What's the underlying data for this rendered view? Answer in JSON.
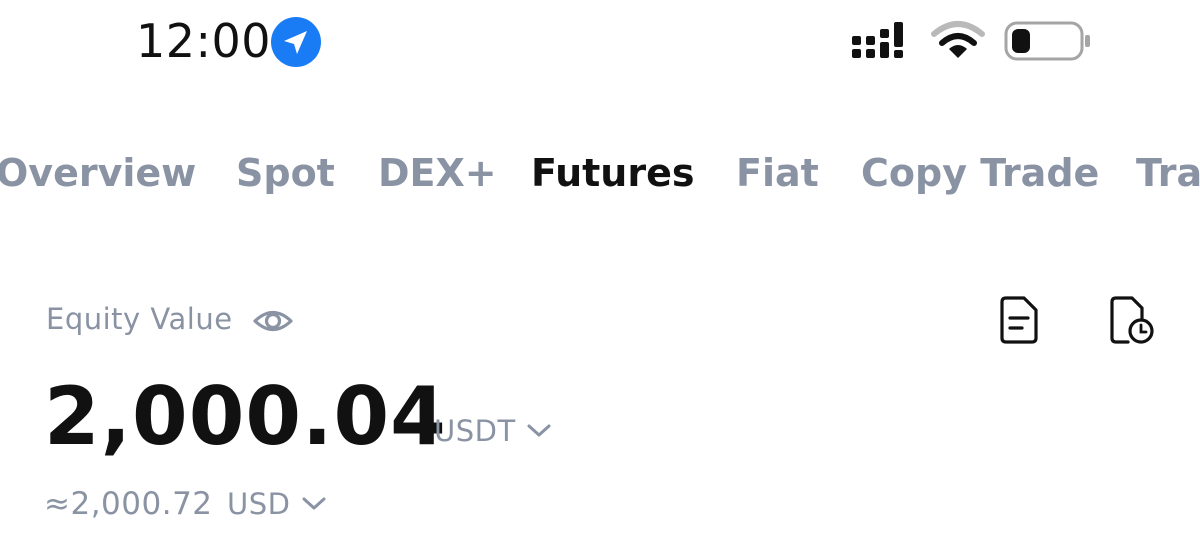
{
  "status_bar": {
    "time": "12:00",
    "icons": [
      "location-arrow-icon",
      "signal-icon",
      "wifi-icon",
      "battery-icon"
    ],
    "location_color": "#1a7cf5"
  },
  "tabs": [
    {
      "label": "Overview",
      "active": false
    },
    {
      "label": "Spot",
      "active": false
    },
    {
      "label": "DEX+",
      "active": false
    },
    {
      "label": "Futures",
      "active": true
    },
    {
      "label": "Fiat",
      "active": false
    },
    {
      "label": "Copy Trade",
      "active": false
    },
    {
      "label": "Tra",
      "active": false
    }
  ],
  "equity": {
    "label": "Equity Value",
    "value": "2,000.04",
    "unit": "USDT",
    "approx_value": "≈2,000.72",
    "approx_unit": "USD"
  },
  "colors": {
    "text_primary": "#111111",
    "text_muted": "#8a93a3",
    "accent_blue": "#1a7cf5"
  }
}
